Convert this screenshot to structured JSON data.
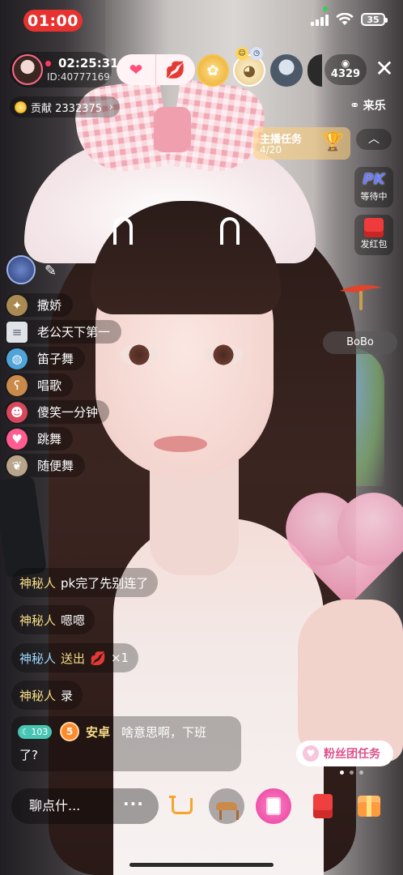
{
  "status_bar": {
    "time": "01:00",
    "battery": "35"
  },
  "host": {
    "duration": "02:25:31",
    "id": "ID:40777169"
  },
  "viewers": {
    "count": "4329"
  },
  "contribution": {
    "label": "贡献 2332375",
    "chevron": "›"
  },
  "brand": {
    "name": "来乐"
  },
  "anchor_task": {
    "title": "主播任务",
    "progress": "4/20"
  },
  "right_rail": {
    "pk": {
      "icon_text": "PK",
      "label": "等待中"
    },
    "red_packet": {
      "label": "发红包"
    },
    "bobo_label": "BoBo"
  },
  "gift_list": [
    {
      "icon": "sparkle-icon",
      "label": "撒娇"
    },
    {
      "icon": "air-conditioner-icon",
      "label": "老公天下第一"
    },
    {
      "icon": "globe-icon",
      "label": "笛子舞"
    },
    {
      "icon": "bear-icon",
      "label": "唱歌"
    },
    {
      "icon": "doll-icon",
      "label": "傻笑一分钟"
    },
    {
      "icon": "heart-icon",
      "label": "跳舞"
    },
    {
      "icon": "ribbon-icon",
      "label": "随便舞"
    }
  ],
  "chat": [
    {
      "nick": "神秘人",
      "text": "pk完了先别连了"
    },
    {
      "nick": "神秘人",
      "text": "嗯嗯"
    },
    {
      "nick": "神秘人",
      "action": "送出",
      "gift_icon": "lips-icon",
      "count": "×1"
    },
    {
      "nick": "神秘人",
      "text": "录"
    }
  ],
  "chat_rich": {
    "level": "103",
    "rank": "5",
    "nick": "安卓",
    "line1": "啥意思啊，下班",
    "line2": "了?"
  },
  "fan_task": {
    "label": "粉丝团任务"
  },
  "bottom_bar": {
    "input_placeholder": "聊点什...",
    "more": "···"
  },
  "colors": {
    "live_red": "#e8322f",
    "nick_gold": "#f7dd87",
    "nick_blue": "#9cd7ff",
    "fan_pink": "#e04f8b"
  }
}
